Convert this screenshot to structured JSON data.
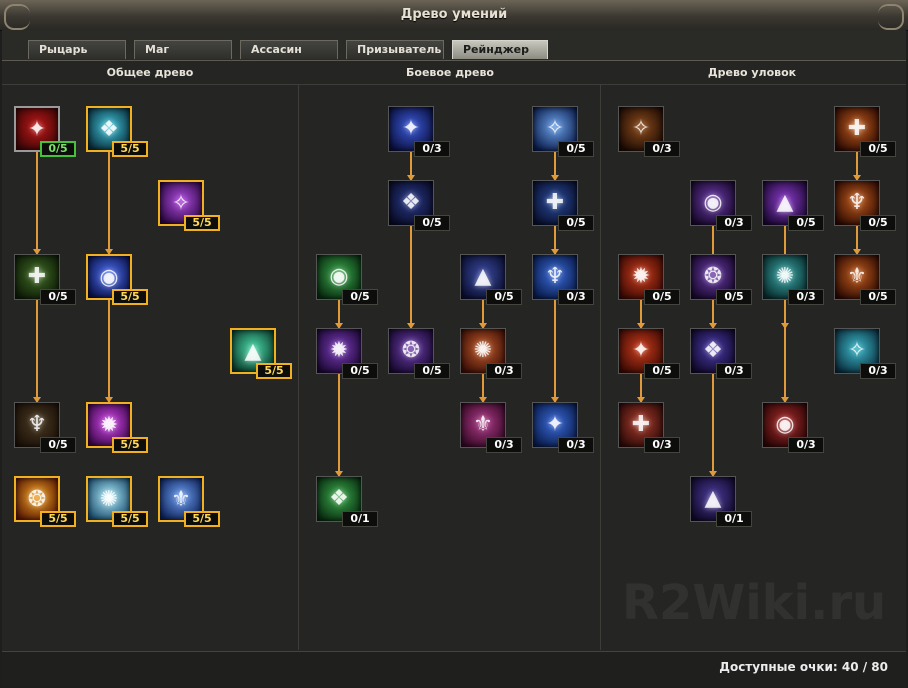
{
  "window": {
    "title": "Древо умений"
  },
  "tabs": [
    {
      "label": "Рыцарь",
      "active": false
    },
    {
      "label": "Маг",
      "active": false
    },
    {
      "label": "Ассасин",
      "active": false
    },
    {
      "label": "Призыватель",
      "active": false
    },
    {
      "label": "Рейнджер",
      "active": true
    }
  ],
  "trees": [
    {
      "label": "Общее древо"
    },
    {
      "label": "Боевое древо"
    },
    {
      "label": "Древо уловок"
    }
  ],
  "footer": {
    "points_label": "Доступные очки: 40 / 80"
  },
  "watermark": "R2Wiki.ru",
  "colors": {
    "maxed_border": "#f0b020",
    "available_border": "#44c23a",
    "connector": "#e09a3a"
  },
  "skills": [
    {
      "id": "g1",
      "level": "0/5",
      "state": "available",
      "icon": "red-figure-icon",
      "bg": [
        "#c01818",
        "#3a0606"
      ]
    },
    {
      "id": "g2",
      "level": "5/5",
      "state": "maxed",
      "icon": "cyan-figure-icon",
      "bg": [
        "#3ec4d8",
        "#0a2c3a"
      ]
    },
    {
      "id": "g3",
      "level": "5/5",
      "state": "maxed",
      "icon": "purple-figure-icon",
      "bg": [
        "#b04ae0",
        "#2a0840"
      ]
    },
    {
      "id": "g4",
      "level": "0/5",
      "state": "normal",
      "icon": "green-cross-icon",
      "bg": [
        "#3e6a22",
        "#0e1a08"
      ]
    },
    {
      "id": "g5",
      "level": "5/5",
      "state": "maxed",
      "icon": "blue-orb-icon",
      "bg": [
        "#4a6cf0",
        "#0a1248"
      ]
    },
    {
      "id": "g6",
      "level": "5/5",
      "state": "maxed",
      "icon": "green-anvil-icon",
      "bg": [
        "#4ad8a8",
        "#0a3a2a"
      ]
    },
    {
      "id": "g7",
      "level": "0/5",
      "state": "normal",
      "icon": "red-cross-icon",
      "bg": [
        "#4a3a22",
        "#1a1008"
      ]
    },
    {
      "id": "g8",
      "level": "5/5",
      "state": "maxed",
      "icon": "pink-orb-icon",
      "bg": [
        "#d044e8",
        "#3a0848"
      ]
    },
    {
      "id": "g9",
      "level": "5/5",
      "state": "maxed",
      "icon": "fire-emblem-icon",
      "bg": [
        "#f0a020",
        "#5a1a04"
      ]
    },
    {
      "id": "g10",
      "level": "5/5",
      "state": "maxed",
      "icon": "ice-emblem-icon",
      "bg": [
        "#a8e8f8",
        "#1a4a6a"
      ]
    },
    {
      "id": "g11",
      "level": "5/5",
      "state": "maxed",
      "icon": "frost-emblem-icon",
      "bg": [
        "#6a9cf0",
        "#0e2258"
      ]
    },
    {
      "id": "c1",
      "level": "0/3",
      "state": "normal",
      "icon": "blue-burst-icon",
      "bg": [
        "#3a5ad8",
        "#0a0e3a"
      ]
    },
    {
      "id": "c2",
      "level": "0/5",
      "state": "normal",
      "icon": "blue-sigil-icon",
      "bg": [
        "#2a3a8a",
        "#080a22"
      ]
    },
    {
      "id": "c3",
      "level": "0/5",
      "state": "normal",
      "icon": "blue-arrows-icon",
      "bg": [
        "#6aa0e8",
        "#0a1a48"
      ]
    },
    {
      "id": "c4",
      "level": "0/5",
      "state": "normal",
      "icon": "beast-head-icon",
      "bg": [
        "#2a4a9a",
        "#080e2a"
      ]
    },
    {
      "id": "c5",
      "level": "0/5",
      "state": "normal",
      "icon": "green-orb-icon",
      "bg": [
        "#3aa84a",
        "#082a10"
      ]
    },
    {
      "id": "c6",
      "level": "0/5",
      "state": "normal",
      "icon": "blue-tree-icon",
      "bg": [
        "#3a4aa0",
        "#0a0e2e"
      ]
    },
    {
      "id": "c7",
      "level": "0/3",
      "state": "normal",
      "icon": "blue-spear-icon",
      "bg": [
        "#3a6ad8",
        "#081a48"
      ]
    },
    {
      "id": "c8",
      "level": "0/5",
      "state": "normal",
      "icon": "violet-rune-icon",
      "bg": [
        "#7a3ab8",
        "#1a0832"
      ]
    },
    {
      "id": "c9",
      "level": "0/5",
      "state": "normal",
      "icon": "violet-sigil-icon",
      "bg": [
        "#6a3aa8",
        "#180a30"
      ]
    },
    {
      "id": "c10",
      "level": "0/3",
      "state": "normal",
      "icon": "orange-tree-icon",
      "bg": [
        "#c05a2a",
        "#3a0e06"
      ]
    },
    {
      "id": "c11",
      "level": "0/3",
      "state": "normal",
      "icon": "pink-tree-icon",
      "bg": [
        "#b03a8a",
        "#320822"
      ]
    },
    {
      "id": "c12",
      "level": "0/3",
      "state": "normal",
      "icon": "blue-spear2-icon",
      "bg": [
        "#3a6ad8",
        "#081a48"
      ]
    },
    {
      "id": "c13",
      "level": "0/1",
      "state": "normal",
      "icon": "green-orb2-icon",
      "bg": [
        "#3aa84a",
        "#082a10"
      ]
    },
    {
      "id": "t1",
      "level": "0/3",
      "state": "normal",
      "icon": "boot-icon",
      "bg": [
        "#8a4a1a",
        "#1a0a04"
      ]
    },
    {
      "id": "t2",
      "level": "0/5",
      "state": "normal",
      "icon": "bow-fire-icon",
      "bg": [
        "#c05a1a",
        "#2a0a04"
      ]
    },
    {
      "id": "t3",
      "level": "0/3",
      "state": "normal",
      "icon": "violet-crest-icon",
      "bg": [
        "#6a3aa8",
        "#160828"
      ]
    },
    {
      "id": "t4",
      "level": "0/5",
      "state": "normal",
      "icon": "violet-claw-icon",
      "bg": [
        "#8a3ac8",
        "#1a0832"
      ]
    },
    {
      "id": "t5",
      "level": "0/5",
      "state": "normal",
      "icon": "bow-fire2-icon",
      "bg": [
        "#c05a1a",
        "#2a0a04"
      ]
    },
    {
      "id": "t6",
      "level": "0/5",
      "state": "normal",
      "icon": "red-arrow-icon",
      "bg": [
        "#c83a1a",
        "#3a0a04"
      ]
    },
    {
      "id": "t7",
      "level": "0/5",
      "state": "normal",
      "icon": "violet-orb-icon",
      "bg": [
        "#6a3aa8",
        "#160828"
      ]
    },
    {
      "id": "t8",
      "level": "0/3",
      "state": "normal",
      "icon": "teal-orb-icon",
      "bg": [
        "#3aa8a8",
        "#082a2a"
      ]
    },
    {
      "id": "t9",
      "level": "0/5",
      "state": "normal",
      "icon": "bow-fire3-icon",
      "bg": [
        "#c05a1a",
        "#2a0a04"
      ]
    },
    {
      "id": "t10",
      "level": "0/5",
      "state": "normal",
      "icon": "red-arrow2-icon",
      "bg": [
        "#c83a1a",
        "#3a0a04"
      ]
    },
    {
      "id": "t11",
      "level": "0/3",
      "state": "normal",
      "icon": "violet-crest2-icon",
      "bg": [
        "#4a3aa8",
        "#100828"
      ]
    },
    {
      "id": "t12",
      "level": "0/3",
      "state": "normal",
      "icon": "teal-claw-icon",
      "bg": [
        "#3ab8c8",
        "#0a2a3a"
      ]
    },
    {
      "id": "t13",
      "level": "0/3",
      "state": "normal",
      "icon": "red-arrow3-icon",
      "bg": [
        "#a83a2a",
        "#2a0a08"
      ]
    },
    {
      "id": "t14",
      "level": "0/3",
      "state": "normal",
      "icon": "red-claw-icon",
      "bg": [
        "#a82a2a",
        "#2a0606"
      ]
    },
    {
      "id": "t15",
      "level": "0/1",
      "state": "normal",
      "icon": "violet-crest3-icon",
      "bg": [
        "#4a3a98",
        "#100826"
      ]
    }
  ]
}
